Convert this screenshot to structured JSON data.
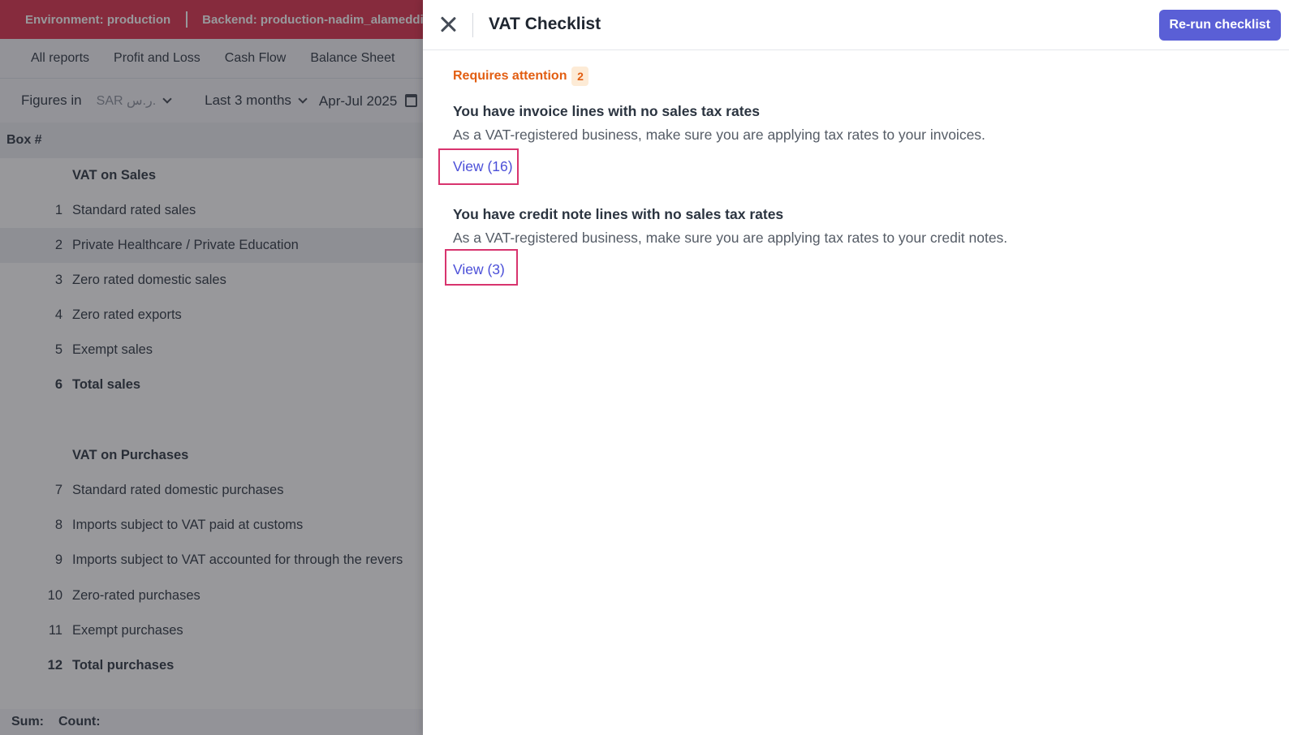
{
  "env_bar": {
    "environment": "Environment: production",
    "backend": "Backend: production-nadim_alameddine-"
  },
  "report_nav": {
    "tabs": [
      "All reports",
      "Profit and Loss",
      "Cash Flow",
      "Balance Sheet"
    ]
  },
  "filters": {
    "figures_label": "Figures in",
    "currency": "SAR ر.س.",
    "range": "Last 3 months",
    "dates": "Apr-Jul 2025"
  },
  "table": {
    "header": "Box #",
    "rows": [
      {
        "num": "",
        "label": "VAT on Sales"
      },
      {
        "num": "1",
        "label": "Standard rated sales"
      },
      {
        "num": "2",
        "label": "Private Healthcare / Private Education"
      },
      {
        "num": "3",
        "label": "Zero rated domestic sales"
      },
      {
        "num": "4",
        "label": "Zero rated exports"
      },
      {
        "num": "5",
        "label": "Exempt sales"
      },
      {
        "num": "6",
        "label": "Total sales"
      },
      {
        "num": "",
        "label": "VAT on Purchases"
      },
      {
        "num": "7",
        "label": "Standard rated domestic purchases"
      },
      {
        "num": "8",
        "label": "Imports subject to VAT paid at customs"
      },
      {
        "num": "9",
        "label": "Imports subject to VAT accounted for through the revers"
      },
      {
        "num": "10",
        "label": "Zero-rated purchases"
      },
      {
        "num": "11",
        "label": "Exempt purchases"
      },
      {
        "num": "12",
        "label": "Total purchases"
      }
    ]
  },
  "footer": {
    "sum_label": "Sum:",
    "count_label": "Count:"
  },
  "drawer": {
    "title": "VAT Checklist",
    "rerun_label": "Re-run checklist",
    "status_label": "Requires attention",
    "status_count": "2",
    "items": [
      {
        "title": "You have invoice lines with no sales tax rates",
        "description": "As a VAT-registered business, make sure you are applying tax rates to your invoices.",
        "link": "View (16)"
      },
      {
        "title": "You have credit note lines with no sales tax rates",
        "description": "As a VAT-registered business, make sure you are applying tax rates to your credit notes.",
        "link": "View (3)"
      }
    ]
  },
  "colors": {
    "env_bar": "#dc2f4c",
    "primary_button": "#5a5fd6",
    "link": "#4b4fd8",
    "warning": "#e25e12",
    "annotation_box": "#d8346e"
  }
}
